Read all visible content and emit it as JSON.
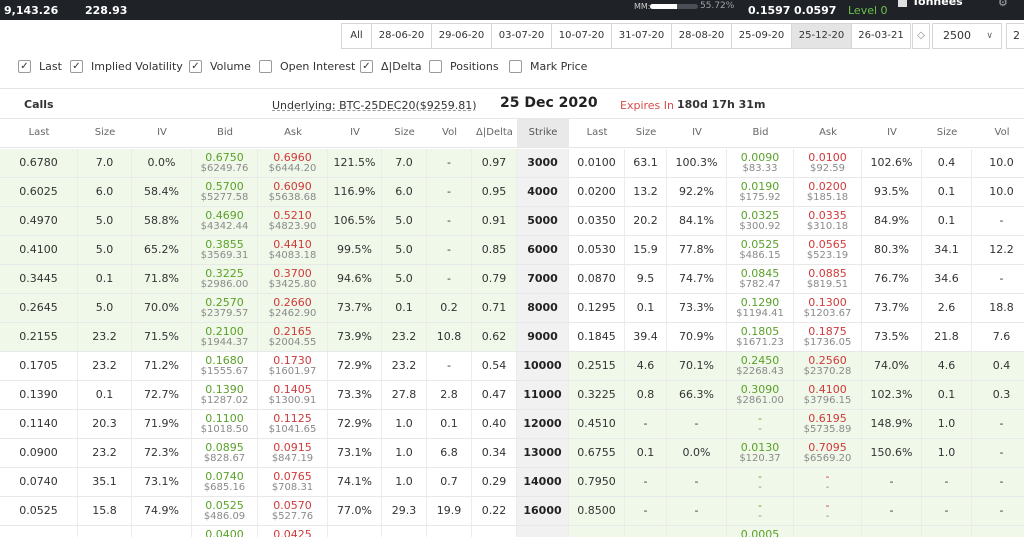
{
  "topbar": {
    "price1": "9,143.26",
    "price2": "228.93",
    "mm_label": "MM:",
    "mm_fraction": 0.5572,
    "mm_pct": "55.72%",
    "val1": "0.1597",
    "val2": "0.0597",
    "level": "Level 0",
    "user": "Tonnees",
    "gear_icon": "gear-icon"
  },
  "tabs": [
    {
      "label": "All",
      "active": false
    },
    {
      "label": "28-06-20",
      "active": false
    },
    {
      "label": "29-06-20",
      "active": false
    },
    {
      "label": "03-07-20",
      "active": false
    },
    {
      "label": "10-07-20",
      "active": false
    },
    {
      "label": "31-07-20",
      "active": false
    },
    {
      "label": "28-08-20",
      "active": false
    },
    {
      "label": "25-09-20",
      "active": false
    },
    {
      "label": "25-12-20",
      "active": true
    },
    {
      "label": "26-03-21",
      "active": false
    }
  ],
  "strike_select": {
    "value": "2500"
  },
  "extra_select": {
    "value": "2"
  },
  "checkboxes": [
    {
      "label": "Last",
      "checked": true
    },
    {
      "label": "Implied Volatility",
      "checked": true
    },
    {
      "label": "Volume",
      "checked": true
    },
    {
      "label": "Open Interest",
      "checked": false
    },
    {
      "label": "Δ|Delta",
      "checked": true
    },
    {
      "label": "Positions",
      "checked": false
    },
    {
      "label": "Mark Price",
      "checked": false
    }
  ],
  "info": {
    "calls": "Calls",
    "underlying": "Underlying: BTC-25DEC20($9259.81)",
    "date": "25 Dec 2020",
    "expires_label": "Expires In",
    "expires_value": "180d 17h 31m"
  },
  "columns": [
    "Last",
    "Size",
    "IV",
    "Bid",
    "Ask",
    "IV",
    "Size",
    "Vol",
    "Δ|Delta",
    "Strike",
    "Last",
    "Size",
    "IV",
    "Bid",
    "Ask",
    "IV",
    "Size",
    "Vol"
  ],
  "rows": [
    {
      "c_last": "0.6780",
      "c_bsize": "7.0",
      "c_biv": "0.0%",
      "c_bid": "0.6750",
      "c_bid_usd": "$6249.76",
      "c_ask": "0.6960",
      "c_ask_usd": "$6444.20",
      "c_aiv": "121.5%",
      "c_asize": "7.0",
      "c_vol": "-",
      "c_delta": "0.97",
      "strike": "3000",
      "p_last": "0.0100",
      "p_bsize": "63.1",
      "p_biv": "100.3%",
      "p_bid": "0.0090",
      "p_bid_usd": "$83.33",
      "p_ask": "0.0100",
      "p_ask_usd": "$92.59",
      "p_aiv": "102.6%",
      "p_asize": "0.4",
      "p_vol": "10.0"
    },
    {
      "c_last": "0.6025",
      "c_bsize": "6.0",
      "c_biv": "58.4%",
      "c_bid": "0.5700",
      "c_bid_usd": "$5277.58",
      "c_ask": "0.6090",
      "c_ask_usd": "$5638.68",
      "c_aiv": "116.9%",
      "c_asize": "6.0",
      "c_vol": "-",
      "c_delta": "0.95",
      "strike": "4000",
      "p_last": "0.0200",
      "p_bsize": "13.2",
      "p_biv": "92.2%",
      "p_bid": "0.0190",
      "p_bid_usd": "$175.92",
      "p_ask": "0.0200",
      "p_ask_usd": "$185.18",
      "p_aiv": "93.5%",
      "p_asize": "0.1",
      "p_vol": "10.0"
    },
    {
      "c_last": "0.4970",
      "c_bsize": "5.0",
      "c_biv": "58.8%",
      "c_bid": "0.4690",
      "c_bid_usd": "$4342.44",
      "c_ask": "0.5210",
      "c_ask_usd": "$4823.90",
      "c_aiv": "106.5%",
      "c_asize": "5.0",
      "c_vol": "-",
      "c_delta": "0.91",
      "strike": "5000",
      "p_last": "0.0350",
      "p_bsize": "20.2",
      "p_biv": "84.1%",
      "p_bid": "0.0325",
      "p_bid_usd": "$300.92",
      "p_ask": "0.0335",
      "p_ask_usd": "$310.18",
      "p_aiv": "84.9%",
      "p_asize": "0.1",
      "p_vol": "-"
    },
    {
      "c_last": "0.4100",
      "c_bsize": "5.0",
      "c_biv": "65.2%",
      "c_bid": "0.3855",
      "c_bid_usd": "$3569.31",
      "c_ask": "0.4410",
      "c_ask_usd": "$4083.18",
      "c_aiv": "99.5%",
      "c_asize": "5.0",
      "c_vol": "-",
      "c_delta": "0.85",
      "strike": "6000",
      "p_last": "0.0530",
      "p_bsize": "15.9",
      "p_biv": "77.8%",
      "p_bid": "0.0525",
      "p_bid_usd": "$486.15",
      "p_ask": "0.0565",
      "p_ask_usd": "$523.19",
      "p_aiv": "80.3%",
      "p_asize": "34.1",
      "p_vol": "12.2"
    },
    {
      "c_last": "0.3445",
      "c_bsize": "0.1",
      "c_biv": "71.8%",
      "c_bid": "0.3225",
      "c_bid_usd": "$2986.00",
      "c_ask": "0.3700",
      "c_ask_usd": "$3425.80",
      "c_aiv": "94.6%",
      "c_asize": "5.0",
      "c_vol": "-",
      "c_delta": "0.79",
      "strike": "7000",
      "p_last": "0.0870",
      "p_bsize": "9.5",
      "p_biv": "74.7%",
      "p_bid": "0.0845",
      "p_bid_usd": "$782.47",
      "p_ask": "0.0885",
      "p_ask_usd": "$819.51",
      "p_aiv": "76.7%",
      "p_asize": "34.6",
      "p_vol": "-"
    },
    {
      "c_last": "0.2645",
      "c_bsize": "5.0",
      "c_biv": "70.0%",
      "c_bid": "0.2570",
      "c_bid_usd": "$2379.57",
      "c_ask": "0.2660",
      "c_ask_usd": "$2462.90",
      "c_aiv": "73.7%",
      "c_asize": "0.1",
      "c_vol": "0.2",
      "c_delta": "0.71",
      "strike": "8000",
      "p_last": "0.1295",
      "p_bsize": "0.1",
      "p_biv": "73.3%",
      "p_bid": "0.1290",
      "p_bid_usd": "$1194.41",
      "p_ask": "0.1300",
      "p_ask_usd": "$1203.67",
      "p_aiv": "73.7%",
      "p_asize": "2.6",
      "p_vol": "18.8"
    },
    {
      "c_last": "0.2155",
      "c_bsize": "23.2",
      "c_biv": "71.5%",
      "c_bid": "0.2100",
      "c_bid_usd": "$1944.37",
      "c_ask": "0.2165",
      "c_ask_usd": "$2004.55",
      "c_aiv": "73.9%",
      "c_asize": "23.2",
      "c_vol": "10.8",
      "c_delta": "0.62",
      "strike": "9000",
      "p_last": "0.1845",
      "p_bsize": "39.4",
      "p_biv": "70.9%",
      "p_bid": "0.1805",
      "p_bid_usd": "$1671.23",
      "p_ask": "0.1875",
      "p_ask_usd": "$1736.05",
      "p_aiv": "73.5%",
      "p_asize": "21.8",
      "p_vol": "7.6"
    },
    {
      "c_last": "0.1705",
      "c_bsize": "23.2",
      "c_biv": "71.2%",
      "c_bid": "0.1680",
      "c_bid_usd": "$1555.67",
      "c_ask": "0.1730",
      "c_ask_usd": "$1601.97",
      "c_aiv": "72.9%",
      "c_asize": "23.2",
      "c_vol": "-",
      "c_delta": "0.54",
      "strike": "10000",
      "p_last": "0.2515",
      "p_bsize": "4.6",
      "p_biv": "70.1%",
      "p_bid": "0.2450",
      "p_bid_usd": "$2268.43",
      "p_ask": "0.2560",
      "p_ask_usd": "$2370.28",
      "p_aiv": "74.0%",
      "p_asize": "4.6",
      "p_vol": "0.4"
    },
    {
      "c_last": "0.1390",
      "c_bsize": "0.1",
      "c_biv": "72.7%",
      "c_bid": "0.1390",
      "c_bid_usd": "$1287.02",
      "c_ask": "0.1405",
      "c_ask_usd": "$1300.91",
      "c_aiv": "73.3%",
      "c_asize": "27.8",
      "c_vol": "2.8",
      "c_delta": "0.47",
      "strike": "11000",
      "p_last": "0.3225",
      "p_bsize": "0.8",
      "p_biv": "66.3%",
      "p_bid": "0.3090",
      "p_bid_usd": "$2861.00",
      "p_ask": "0.4100",
      "p_ask_usd": "$3796.15",
      "p_aiv": "102.3%",
      "p_asize": "0.1",
      "p_vol": "0.3"
    },
    {
      "c_last": "0.1140",
      "c_bsize": "20.3",
      "c_biv": "71.9%",
      "c_bid": "0.1100",
      "c_bid_usd": "$1018.50",
      "c_ask": "0.1125",
      "c_ask_usd": "$1041.65",
      "c_aiv": "72.9%",
      "c_asize": "1.0",
      "c_vol": "0.1",
      "c_delta": "0.40",
      "strike": "12000",
      "p_last": "0.4510",
      "p_bsize": "-",
      "p_biv": "-",
      "p_bid": "-",
      "p_bid_usd": "-",
      "p_ask": "0.6195",
      "p_ask_usd": "$5735.89",
      "p_aiv": "148.9%",
      "p_asize": "1.0",
      "p_vol": "-"
    },
    {
      "c_last": "0.0900",
      "c_bsize": "23.2",
      "c_biv": "72.3%",
      "c_bid": "0.0895",
      "c_bid_usd": "$828.67",
      "c_ask": "0.0915",
      "c_ask_usd": "$847.19",
      "c_aiv": "73.1%",
      "c_asize": "1.0",
      "c_vol": "6.8",
      "c_delta": "0.34",
      "strike": "13000",
      "p_last": "0.6755",
      "p_bsize": "0.1",
      "p_biv": "0.0%",
      "p_bid": "0.0130",
      "p_bid_usd": "$120.37",
      "p_ask": "0.7095",
      "p_ask_usd": "$6569.20",
      "p_aiv": "150.6%",
      "p_asize": "1.0",
      "p_vol": "-"
    },
    {
      "c_last": "0.0740",
      "c_bsize": "35.1",
      "c_biv": "73.1%",
      "c_bid": "0.0740",
      "c_bid_usd": "$685.16",
      "c_ask": "0.0765",
      "c_ask_usd": "$708.31",
      "c_aiv": "74.1%",
      "c_asize": "1.0",
      "c_vol": "0.7",
      "c_delta": "0.29",
      "strike": "14000",
      "p_last": "0.7950",
      "p_bsize": "-",
      "p_biv": "-",
      "p_bid": "-",
      "p_bid_usd": "-",
      "p_ask": "-",
      "p_ask_usd": "-",
      "p_aiv": "-",
      "p_asize": "-",
      "p_vol": "-"
    },
    {
      "c_last": "0.0525",
      "c_bsize": "15.8",
      "c_biv": "74.9%",
      "c_bid": "0.0525",
      "c_bid_usd": "$486.09",
      "c_ask": "0.0570",
      "c_ask_usd": "$527.76",
      "c_aiv": "77.0%",
      "c_asize": "29.3",
      "c_vol": "19.9",
      "c_delta": "0.22",
      "strike": "16000",
      "p_last": "0.8500",
      "p_bsize": "-",
      "p_biv": "-",
      "p_bid": "-",
      "p_bid_usd": "-",
      "p_ask": "-",
      "p_ask_usd": "-",
      "p_aiv": "-",
      "p_asize": "-",
      "p_vol": "-"
    },
    {
      "c_last": "",
      "c_bsize": "",
      "c_biv": "",
      "c_bid": "0.0400",
      "c_bid_usd": "",
      "c_ask": "0.0425",
      "c_ask_usd": "",
      "c_aiv": "",
      "c_asize": "",
      "c_vol": "",
      "c_delta": "",
      "strike": "",
      "p_last": "",
      "p_bsize": "",
      "p_biv": "",
      "p_bid": "0.0005",
      "p_bid_usd": "",
      "p_ask": "",
      "p_ask_usd": "",
      "p_aiv": "",
      "p_asize": "",
      "p_vol": ""
    }
  ],
  "colors": {
    "bid": "#5ba12a",
    "ask": "#d03a3a",
    "itm": "#f0f8e9",
    "level": "#6bc24a",
    "expires": "#d84b4b"
  }
}
